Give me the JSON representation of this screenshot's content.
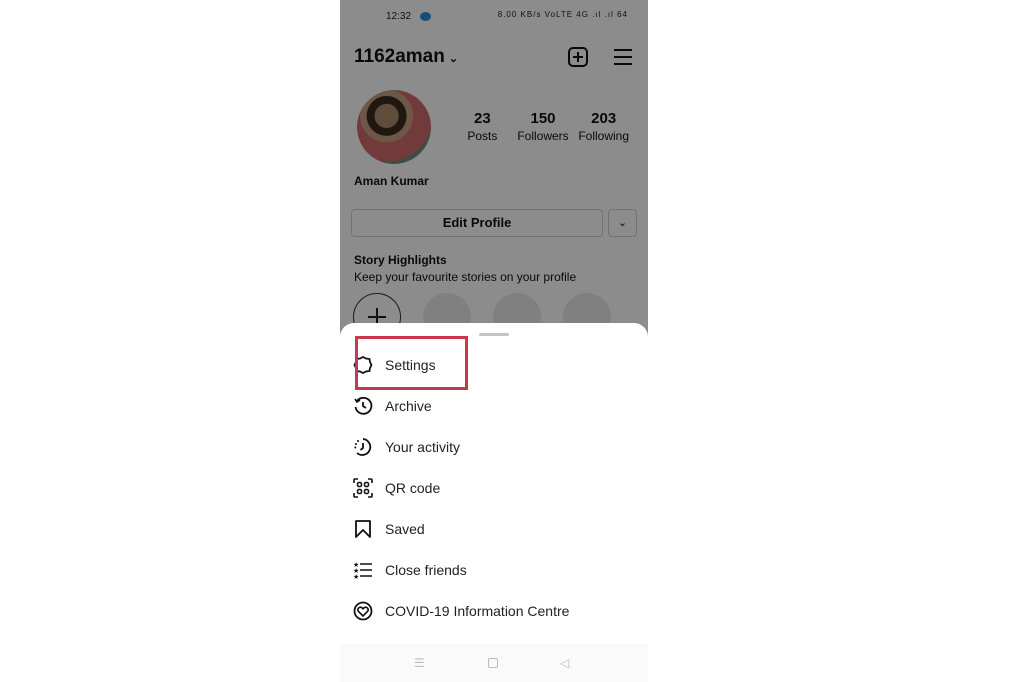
{
  "status_bar": {
    "time": "12:32",
    "indicators": "8.00 KB/s  VoLTE  4G  .ıl  .ıl  64"
  },
  "profile": {
    "username": "1162aman",
    "username_chevron_icon": "chevron-down-icon",
    "new_post_icon": "plus-square-icon",
    "menu_icon": "hamburger-menu-icon",
    "full_name": "Aman Kumar",
    "stats": [
      {
        "value": "23",
        "label": "Posts"
      },
      {
        "value": "150",
        "label": "Followers"
      },
      {
        "value": "203",
        "label": "Following"
      }
    ],
    "edit_profile_label": "Edit Profile",
    "story_highlights_title": "Story Highlights",
    "story_highlights_subtitle": "Keep your favourite stories on your profile"
  },
  "menu": {
    "items": [
      {
        "label": "Settings",
        "icon": "gear-icon"
      },
      {
        "label": "Archive",
        "icon": "archive-clock-icon"
      },
      {
        "label": "Your activity",
        "icon": "activity-clock-icon"
      },
      {
        "label": "QR code",
        "icon": "qr-code-icon"
      },
      {
        "label": "Saved",
        "icon": "bookmark-icon"
      },
      {
        "label": "Close friends",
        "icon": "close-friends-list-icon"
      },
      {
        "label": "COVID-19 Information Centre",
        "icon": "covid-heart-icon"
      }
    ],
    "highlighted_item": "Settings",
    "highlight_color": "#c9384c"
  },
  "navbar": {
    "recent_icon": "recent-apps-icon",
    "home_icon": "home-square-icon",
    "back_icon": "back-triangle-icon"
  }
}
